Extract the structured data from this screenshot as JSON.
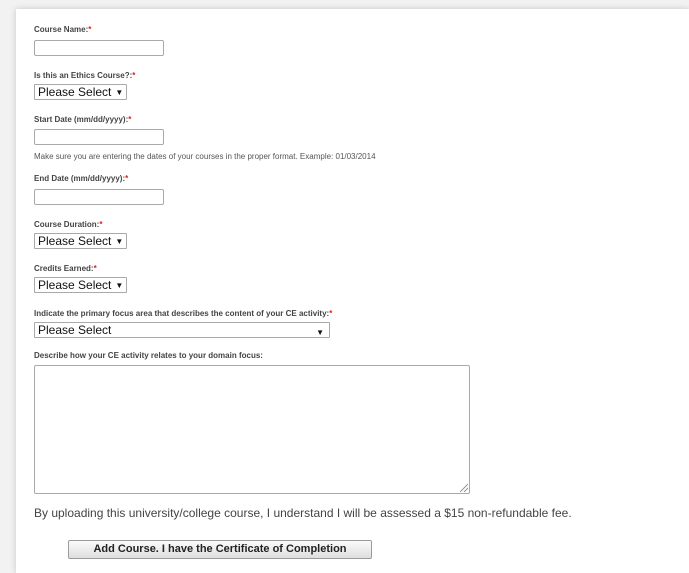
{
  "form": {
    "course_name": {
      "label": "Course Name:",
      "required_mark": "*",
      "value": ""
    },
    "ethics_course": {
      "label": "Is this an Ethics Course?:",
      "required_mark": "*",
      "selected": "Please Select"
    },
    "start_date": {
      "label": "Start Date (mm/dd/yyyy):",
      "required_mark": "*",
      "value": "",
      "hint": "Make sure you are entering the dates of your courses in the proper format. Example: 01/03/2014"
    },
    "end_date": {
      "label": "End Date (mm/dd/yyyy):",
      "required_mark": "*",
      "value": ""
    },
    "course_duration": {
      "label": "Course Duration:",
      "required_mark": "*",
      "selected": "Please Select"
    },
    "credits_earned": {
      "label": "Credits Earned:",
      "required_mark": "*",
      "selected": "Please Select"
    },
    "focus_area": {
      "label": "Indicate the primary focus area that describes the content of your CE activity:",
      "required_mark": "*",
      "selected": "Please Select"
    },
    "domain_focus": {
      "label": "Describe how your CE activity relates to your domain focus:",
      "value": ""
    },
    "fee_notice": "By uploading this university/college course, I understand I will be assessed a $15 non-refundable fee.",
    "submit_label": "Add Course. I have the Certificate of Completion"
  },
  "icons": {
    "select_arrow": "▼"
  },
  "colors": {
    "required": "#d9221c",
    "background": "#f2f2f2",
    "panel": "#ffffff"
  }
}
